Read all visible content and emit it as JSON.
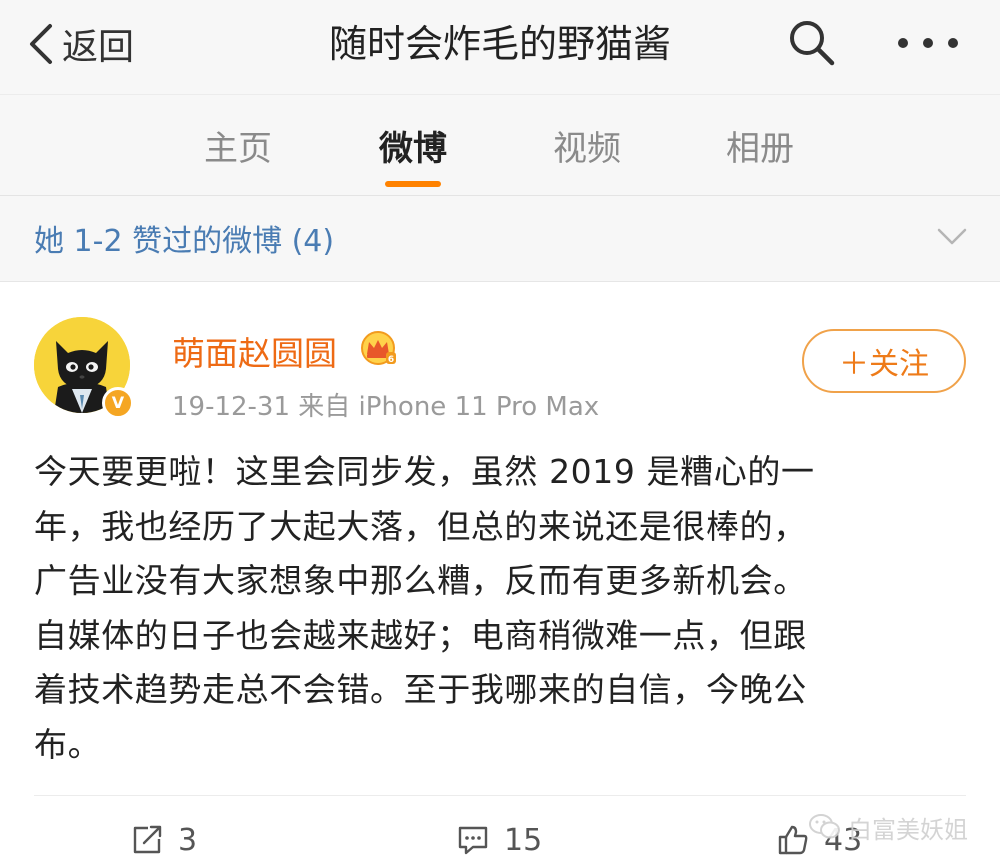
{
  "nav": {
    "back_label": "返回",
    "title": "随时会炸毛的野猫酱"
  },
  "tabs": [
    {
      "label": "主页",
      "active": false
    },
    {
      "label": "微博",
      "active": true
    },
    {
      "label": "视频",
      "active": false
    },
    {
      "label": "相册",
      "active": false
    }
  ],
  "liked_banner": {
    "text": "她 1-2 赞过的微博 (4)"
  },
  "post": {
    "author": "萌面赵圆圆",
    "meta": "19-12-31  来自 iPhone 11 Pro Max",
    "follow_label": "＋关注",
    "content_lines": [
      "今天要更啦！这里会同步发，虽然 2019 是糟心的一",
      "年，我也经历了大起大落，但总的来说还是很棒的，",
      "广告业没有大家想象中那么糟，反而有更多新机会。",
      "自媒体的日子也会越来越好；电商稍微难一点，但跟",
      "着技术趋势走总不会错。至于我哪来的自信，今晚公",
      "布。"
    ],
    "actions": {
      "repost_count": "3",
      "comment_count": "15",
      "like_count": "43"
    }
  },
  "watermark": "白富美妖姐",
  "colors": {
    "accent": "#ff8200",
    "username": "#ee6a14",
    "link_blue": "#4a7cb3",
    "follow_border": "#f0a24a"
  },
  "icons": {
    "back": "chevron-left-icon",
    "search": "search-icon",
    "more": "more-dots-icon",
    "chevron": "chevron-down-icon",
    "vip": "crown-icon",
    "verified": "verified-v-icon",
    "repost": "repost-icon",
    "comment": "comment-icon",
    "like": "thumbs-up-icon",
    "watermark": "wechat-icon"
  }
}
